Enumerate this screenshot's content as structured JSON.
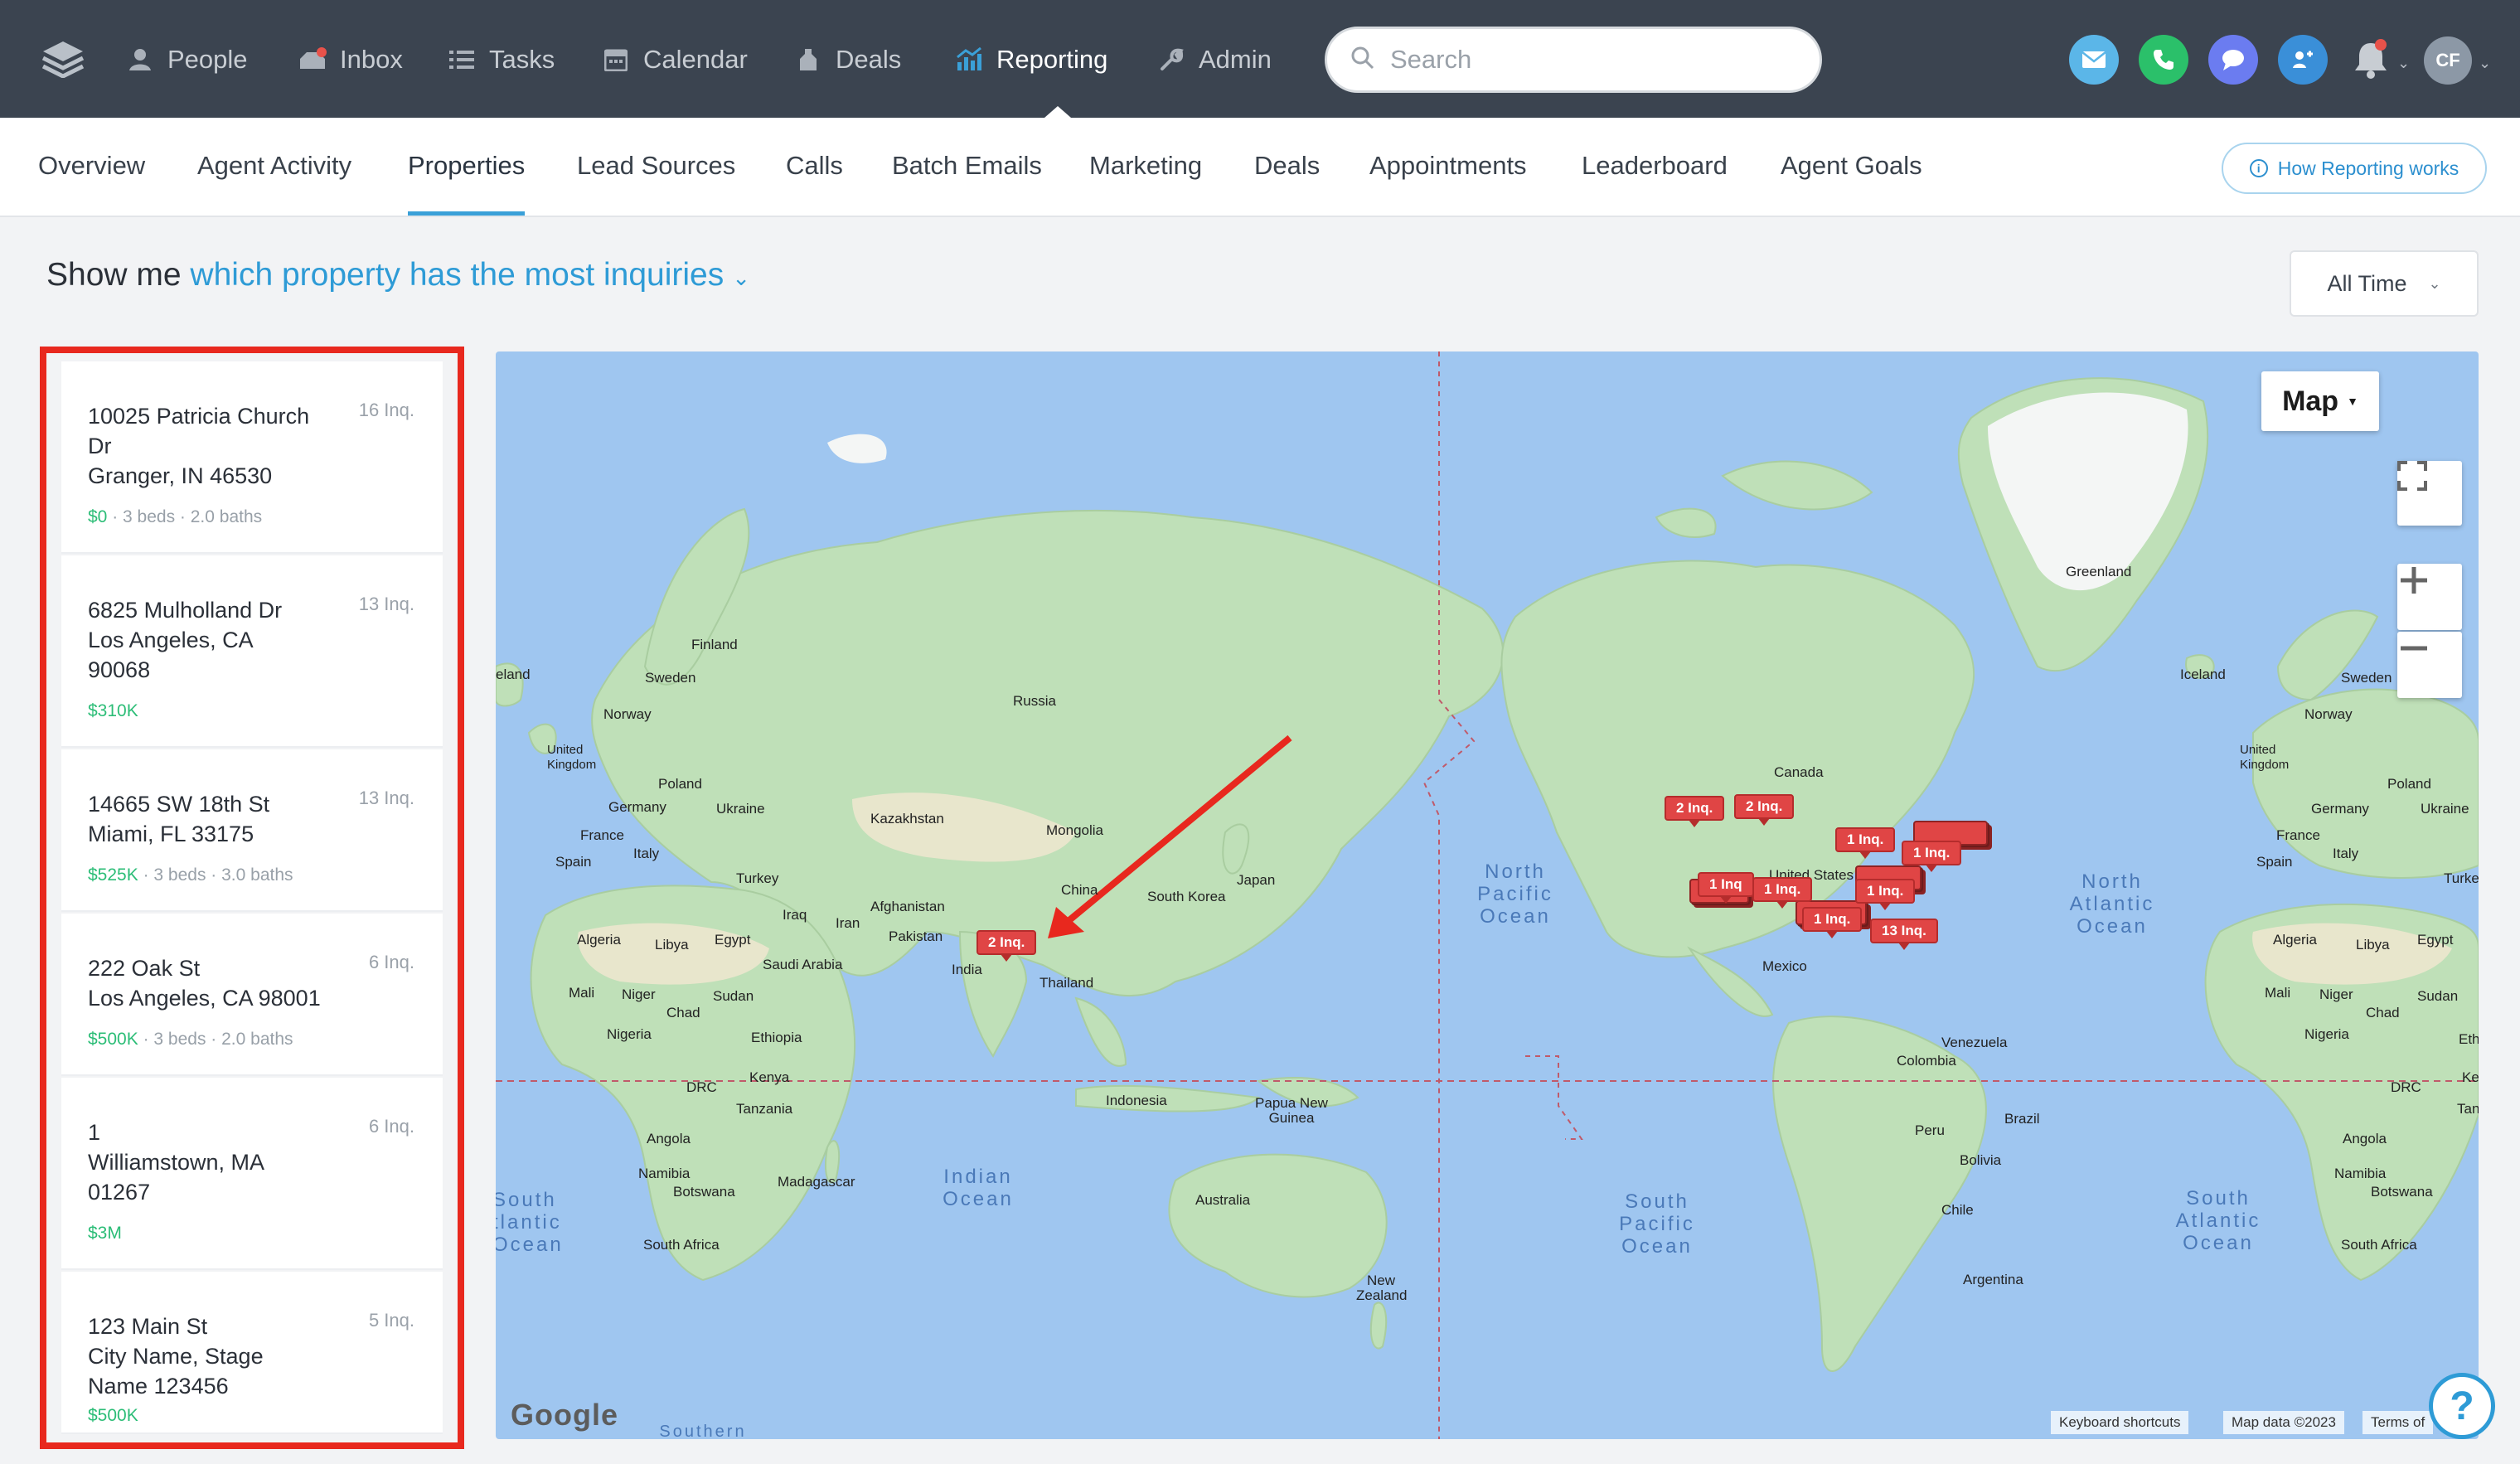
{
  "nav": {
    "items": [
      {
        "label": "People",
        "icon": "person-icon"
      },
      {
        "label": "Inbox",
        "icon": "inbox-icon"
      },
      {
        "label": "Tasks",
        "icon": "list-icon"
      },
      {
        "label": "Calendar",
        "icon": "calendar-icon"
      },
      {
        "label": "Deals",
        "icon": "deals-icon"
      },
      {
        "label": "Reporting",
        "icon": "chart-icon",
        "active": true
      },
      {
        "label": "Admin",
        "icon": "wrench-icon"
      }
    ],
    "search_placeholder": "Search",
    "avatar_initials": "CF",
    "colors": {
      "bg": "#3b4450",
      "email": "#5bb6e8",
      "phone": "#2bc06a",
      "chat": "#6b7cf0",
      "dialer": "#3a8fd8"
    }
  },
  "subnav": {
    "tabs": [
      "Overview",
      "Agent Activity",
      "Properties",
      "Lead Sources",
      "Calls",
      "Batch Emails",
      "Marketing",
      "Deals",
      "Appointments",
      "Leaderboard",
      "Agent Goals"
    ],
    "active_tab": "Properties",
    "help_label": "How Reporting works"
  },
  "header": {
    "prefix": "Show me",
    "question": "which property has the most inquiries",
    "time_filter": "All Time"
  },
  "properties": [
    {
      "address": "10025 Patricia Church Dr\nGranger, IN 46530",
      "inquiries": "16 Inq.",
      "price": "$0",
      "details": " · 3 beds · 2.0 baths"
    },
    {
      "address": "6825 Mulholland Dr\nLos Angeles, CA\n90068",
      "inquiries": "13 Inq.",
      "price": "$310K",
      "details": ""
    },
    {
      "address": "14665 SW 18th St\nMiami, FL 33175",
      "inquiries": "13 Inq.",
      "price": "$525K",
      "details": " · 3 beds · 3.0 baths"
    },
    {
      "address": "222 Oak St\nLos Angeles, CA 98001",
      "inquiries": "6 Inq.",
      "price": "$500K",
      "details": " · 3 beds · 2.0 baths"
    },
    {
      "address": "1\nWilliamstown, MA\n01267",
      "inquiries": "6 Inq.",
      "price": "$3M",
      "details": ""
    },
    {
      "address": "123 Main St\nCity Name, Stage\nName 123456",
      "inquiries": "5 Inq.",
      "price": "$500K",
      "details": ""
    }
  ],
  "map": {
    "type_label": "Map",
    "oceans": {
      "north_pacific": "North\nPacific\nOcean",
      "north_atlantic": "North\nAtlantic\nOcean",
      "indian": "Indian\nOcean",
      "south_pacific": "South\nPacific\nOcean",
      "south_atlantic": "South\nAtlantic\nOcean",
      "south_atlantic_left": "South\ntlantic\nOcean"
    },
    "places": [
      "Greenland",
      "Iceland",
      "Finland",
      "Sweden",
      "Norway",
      "Russia",
      "United Kingdom",
      "Poland",
      "Germany",
      "Ukraine",
      "France",
      "Italy",
      "Spain",
      "Kazakhstan",
      "Mongolia",
      "Turkey",
      "Iraq",
      "Iran",
      "Afghanistan",
      "Pakistan",
      "China",
      "South Korea",
      "Japan",
      "India",
      "Thailand",
      "Algeria",
      "Libya",
      "Egypt",
      "Saudi Arabia",
      "Mali",
      "Niger",
      "Chad",
      "Sudan",
      "Nigeria",
      "Ethiopia",
      "DRC",
      "Kenya",
      "Tanzania",
      "Angola",
      "Namibia",
      "Botswana",
      "Madagascar",
      "South Africa",
      "Indonesia",
      "Papua New Guinea",
      "Australia",
      "New Zealand",
      "Canada",
      "United States",
      "Mexico",
      "Venezuela",
      "Colombia",
      "Peru",
      "Brazil",
      "Bolivia",
      "Chile",
      "Argentina",
      "Sweden",
      "Norway",
      "United Kingdom",
      "Poland",
      "Germany",
      "Ukraine",
      "France",
      "Italy",
      "Spain",
      "Turkey",
      "Algeria",
      "Libya",
      "Egypt",
      "Mali",
      "Niger",
      "Chad",
      "Sudan",
      "Nigeria",
      "DRC",
      "Angola",
      "Namibia",
      "Botswana",
      "South Africa",
      "eland",
      "Ethic",
      "Keny",
      "Tanza"
    ],
    "pins": [
      "2 Inq.",
      "2 Inq.",
      "2 Inq.",
      "1 Inq.",
      "1 Inq.",
      "1 Inq",
      "1 Inq.",
      "1 Inq.",
      "1 Inq.",
      "13 Inq."
    ],
    "google": "Google",
    "shortcuts": "Keyboard shortcuts",
    "map_data": "Map data ©2023",
    "terms": "Terms of",
    "southern": "Southern"
  }
}
